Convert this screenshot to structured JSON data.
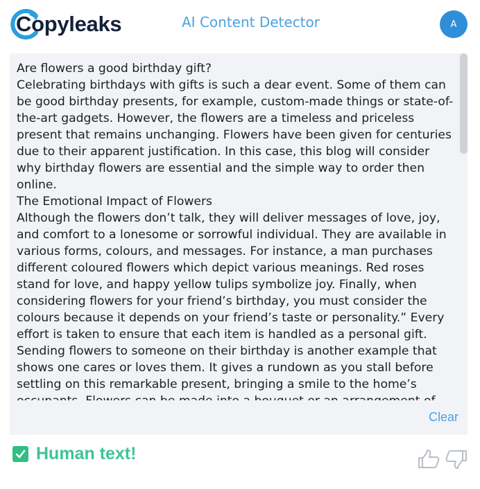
{
  "header": {
    "logo_text": "Copyleaks",
    "app_title": "AI Content Detector",
    "avatar_letter": "A"
  },
  "content": {
    "paragraphs": [
      "Are flowers a good birthday gift?",
      "Celebrating birthdays with gifts is such a dear event. Some of them can be good birthday presents, for example, custom-made things or state-of-the-art gadgets. However, the flowers are a timeless and priceless present that remains unchanging. Flowers have been given for centuries due to their apparent justification. In this case, this blog will consider why birthday flowers are essential and the simple way to order then online.",
      "The Emotional Impact of Flowers",
      "Although the flowers don’t talk, they will deliver messages of love, joy, and comfort to a lonesome or sorrowful individual. They are available in various forms, colours, and messages. For instance, a man purchases different coloured flowers which depict various meanings. Red roses stand for love, and happy yellow tulips symbolize joy. Finally, when considering flowers for your friend’s birthday, you must consider the colours because it depends on your friend’s taste or personality.” Every effort is taken to ensure that each item is handled as a personal gift.",
      "Sending flowers to someone on their birthday is another example that shows one cares or loves them. It gives a rundown as you stall before settling on this remarkable present, bringing a smile to the home’s occupants. Flowers can be made into a bouquet or an arrangement of their favourite flower; it is guaranteed that anybody would love this, irrespective of how"
    ],
    "clear_label": "Clear"
  },
  "result": {
    "label": "Human text!",
    "status_color": "#2fbf85"
  },
  "icons": {
    "logo": "copyleaks-logo-icon",
    "check": "check-icon",
    "like": "thumbs-up-icon",
    "dislike": "thumbs-down-icon"
  },
  "colors": {
    "accent": "#4aa3e0",
    "avatar_bg": "#2f8ed8",
    "human_green": "#3fc39a",
    "panel_bg": "#f1f3f6"
  }
}
